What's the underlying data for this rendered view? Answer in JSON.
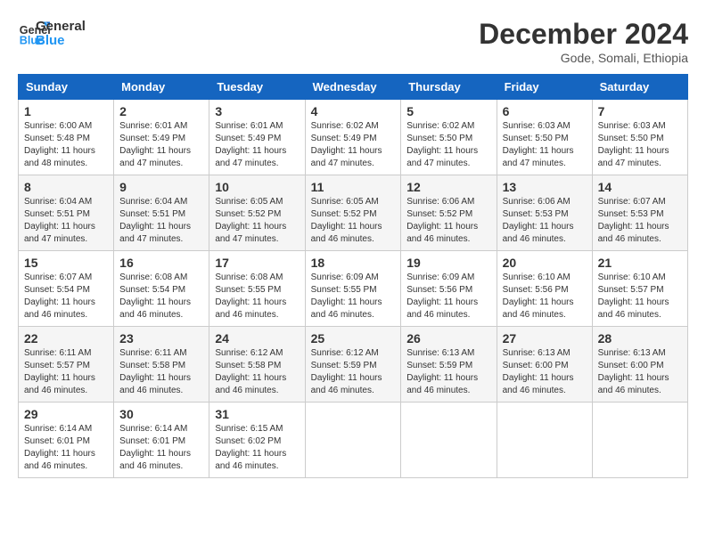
{
  "logo": {
    "line1": "General",
    "line2": "Blue"
  },
  "title": "December 2024",
  "location": "Gode, Somali, Ethiopia",
  "days_of_week": [
    "Sunday",
    "Monday",
    "Tuesday",
    "Wednesday",
    "Thursday",
    "Friday",
    "Saturday"
  ],
  "weeks": [
    [
      {
        "day": "1",
        "info": "Sunrise: 6:00 AM\nSunset: 5:48 PM\nDaylight: 11 hours\nand 48 minutes."
      },
      {
        "day": "2",
        "info": "Sunrise: 6:01 AM\nSunset: 5:49 PM\nDaylight: 11 hours\nand 47 minutes."
      },
      {
        "day": "3",
        "info": "Sunrise: 6:01 AM\nSunset: 5:49 PM\nDaylight: 11 hours\nand 47 minutes."
      },
      {
        "day": "4",
        "info": "Sunrise: 6:02 AM\nSunset: 5:49 PM\nDaylight: 11 hours\nand 47 minutes."
      },
      {
        "day": "5",
        "info": "Sunrise: 6:02 AM\nSunset: 5:50 PM\nDaylight: 11 hours\nand 47 minutes."
      },
      {
        "day": "6",
        "info": "Sunrise: 6:03 AM\nSunset: 5:50 PM\nDaylight: 11 hours\nand 47 minutes."
      },
      {
        "day": "7",
        "info": "Sunrise: 6:03 AM\nSunset: 5:50 PM\nDaylight: 11 hours\nand 47 minutes."
      }
    ],
    [
      {
        "day": "8",
        "info": "Sunrise: 6:04 AM\nSunset: 5:51 PM\nDaylight: 11 hours\nand 47 minutes."
      },
      {
        "day": "9",
        "info": "Sunrise: 6:04 AM\nSunset: 5:51 PM\nDaylight: 11 hours\nand 47 minutes."
      },
      {
        "day": "10",
        "info": "Sunrise: 6:05 AM\nSunset: 5:52 PM\nDaylight: 11 hours\nand 47 minutes."
      },
      {
        "day": "11",
        "info": "Sunrise: 6:05 AM\nSunset: 5:52 PM\nDaylight: 11 hours\nand 46 minutes."
      },
      {
        "day": "12",
        "info": "Sunrise: 6:06 AM\nSunset: 5:52 PM\nDaylight: 11 hours\nand 46 minutes."
      },
      {
        "day": "13",
        "info": "Sunrise: 6:06 AM\nSunset: 5:53 PM\nDaylight: 11 hours\nand 46 minutes."
      },
      {
        "day": "14",
        "info": "Sunrise: 6:07 AM\nSunset: 5:53 PM\nDaylight: 11 hours\nand 46 minutes."
      }
    ],
    [
      {
        "day": "15",
        "info": "Sunrise: 6:07 AM\nSunset: 5:54 PM\nDaylight: 11 hours\nand 46 minutes."
      },
      {
        "day": "16",
        "info": "Sunrise: 6:08 AM\nSunset: 5:54 PM\nDaylight: 11 hours\nand 46 minutes."
      },
      {
        "day": "17",
        "info": "Sunrise: 6:08 AM\nSunset: 5:55 PM\nDaylight: 11 hours\nand 46 minutes."
      },
      {
        "day": "18",
        "info": "Sunrise: 6:09 AM\nSunset: 5:55 PM\nDaylight: 11 hours\nand 46 minutes."
      },
      {
        "day": "19",
        "info": "Sunrise: 6:09 AM\nSunset: 5:56 PM\nDaylight: 11 hours\nand 46 minutes."
      },
      {
        "day": "20",
        "info": "Sunrise: 6:10 AM\nSunset: 5:56 PM\nDaylight: 11 hours\nand 46 minutes."
      },
      {
        "day": "21",
        "info": "Sunrise: 6:10 AM\nSunset: 5:57 PM\nDaylight: 11 hours\nand 46 minutes."
      }
    ],
    [
      {
        "day": "22",
        "info": "Sunrise: 6:11 AM\nSunset: 5:57 PM\nDaylight: 11 hours\nand 46 minutes."
      },
      {
        "day": "23",
        "info": "Sunrise: 6:11 AM\nSunset: 5:58 PM\nDaylight: 11 hours\nand 46 minutes."
      },
      {
        "day": "24",
        "info": "Sunrise: 6:12 AM\nSunset: 5:58 PM\nDaylight: 11 hours\nand 46 minutes."
      },
      {
        "day": "25",
        "info": "Sunrise: 6:12 AM\nSunset: 5:59 PM\nDaylight: 11 hours\nand 46 minutes."
      },
      {
        "day": "26",
        "info": "Sunrise: 6:13 AM\nSunset: 5:59 PM\nDaylight: 11 hours\nand 46 minutes."
      },
      {
        "day": "27",
        "info": "Sunrise: 6:13 AM\nSunset: 6:00 PM\nDaylight: 11 hours\nand 46 minutes."
      },
      {
        "day": "28",
        "info": "Sunrise: 6:13 AM\nSunset: 6:00 PM\nDaylight: 11 hours\nand 46 minutes."
      }
    ],
    [
      {
        "day": "29",
        "info": "Sunrise: 6:14 AM\nSunset: 6:01 PM\nDaylight: 11 hours\nand 46 minutes."
      },
      {
        "day": "30",
        "info": "Sunrise: 6:14 AM\nSunset: 6:01 PM\nDaylight: 11 hours\nand 46 minutes."
      },
      {
        "day": "31",
        "info": "Sunrise: 6:15 AM\nSunset: 6:02 PM\nDaylight: 11 hours\nand 46 minutes."
      },
      {
        "day": "",
        "info": ""
      },
      {
        "day": "",
        "info": ""
      },
      {
        "day": "",
        "info": ""
      },
      {
        "day": "",
        "info": ""
      }
    ]
  ]
}
